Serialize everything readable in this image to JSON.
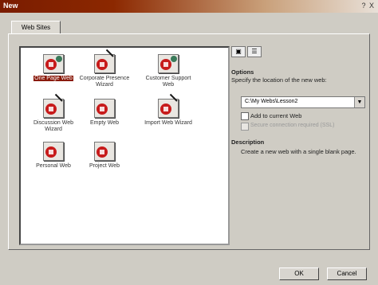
{
  "window": {
    "title": "New",
    "controls": "? X"
  },
  "tabs": [
    {
      "label": "Web Sites"
    }
  ],
  "templates": [
    {
      "label": "One Page Web",
      "selected": true,
      "icon": "web-template-icon"
    },
    {
      "label": "Corporate Presence Wizard",
      "icon": "wizard-template-icon"
    },
    {
      "label": "Customer Support Web",
      "icon": "web-template-icon"
    },
    {
      "label": "Discussion Web Wizard",
      "icon": "wizard-template-icon"
    },
    {
      "label": "Empty Web",
      "icon": "web-template-icon"
    },
    {
      "label": "Import Web Wizard",
      "icon": "wizard-template-icon"
    },
    {
      "label": "Personal Web",
      "icon": "web-template-icon"
    },
    {
      "label": "Project Web",
      "icon": "web-template-icon"
    }
  ],
  "view_buttons": {
    "large_icons": "large-icons-view-icon",
    "list": "list-view-icon"
  },
  "options": {
    "header": "Options",
    "location_label": "Specify the location of the new web:",
    "location_value": "C:\\My Webs\\Lesson2",
    "add_to_current": "Add to current Web",
    "secure": "Secure connection required (SSL)"
  },
  "description": {
    "header": "Description",
    "text": "Create a new web with a single blank page."
  },
  "buttons": {
    "ok": "OK",
    "cancel": "Cancel"
  }
}
